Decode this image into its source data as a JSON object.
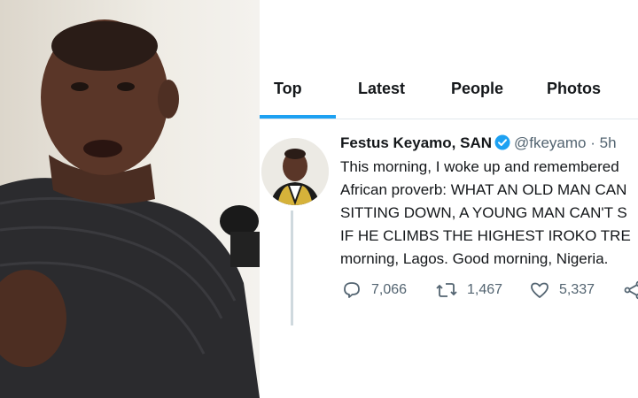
{
  "photo": {
    "description_icon": "person-speaking-photo"
  },
  "tabs": [
    {
      "label": "Top",
      "active": true
    },
    {
      "label": "Latest",
      "active": false
    },
    {
      "label": "People",
      "active": false
    },
    {
      "label": "Photos",
      "active": false
    }
  ],
  "tweet": {
    "name": "Festus Keyamo, SAN",
    "handle": "@fkeyamo",
    "separator": "·",
    "time": "5h",
    "lines": [
      "This morning, I woke up and remembered",
      "African proverb: WHAT AN OLD MAN CAN",
      "SITTING DOWN, A YOUNG MAN CAN'T S",
      "IF HE CLIMBS THE HIGHEST IROKO TRE",
      "morning, Lagos. Good morning, Nigeria."
    ],
    "replies": "7,066",
    "retweets": "1,467",
    "likes": "5,337"
  },
  "colors": {
    "accent": "#1da1f2",
    "text": "#14171a",
    "muted": "#536471"
  },
  "icons": [
    "verified-badge-icon",
    "reply-icon",
    "retweet-icon",
    "like-icon",
    "share-icon"
  ]
}
